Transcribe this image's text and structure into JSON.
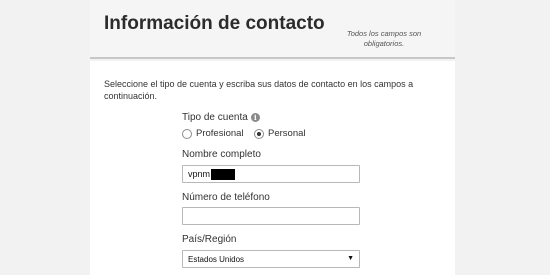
{
  "header": {
    "title": "Información de contacto",
    "required_note": "Todos los campos son obligatorios."
  },
  "card": {
    "instructions": "Seleccione el tipo de cuenta y escriba sus datos de contacto en los campos a continuación.",
    "account_type": {
      "label": "Tipo de cuenta",
      "info_icon": "info-icon",
      "options": [
        "Profesional",
        "Personal"
      ],
      "selected": "Personal"
    },
    "full_name": {
      "label": "Nombre completo",
      "value": "vpnm"
    },
    "phone": {
      "label": "Número de teléfono",
      "value": ""
    },
    "country": {
      "label": "País/Región",
      "value": "Estados Unidos",
      "caret_icon": "dropdown-caret-icon"
    }
  },
  "colors": {
    "page_background": "#f2f2f2",
    "card_background": "#ffffff",
    "divider": "#c7c7c7"
  }
}
